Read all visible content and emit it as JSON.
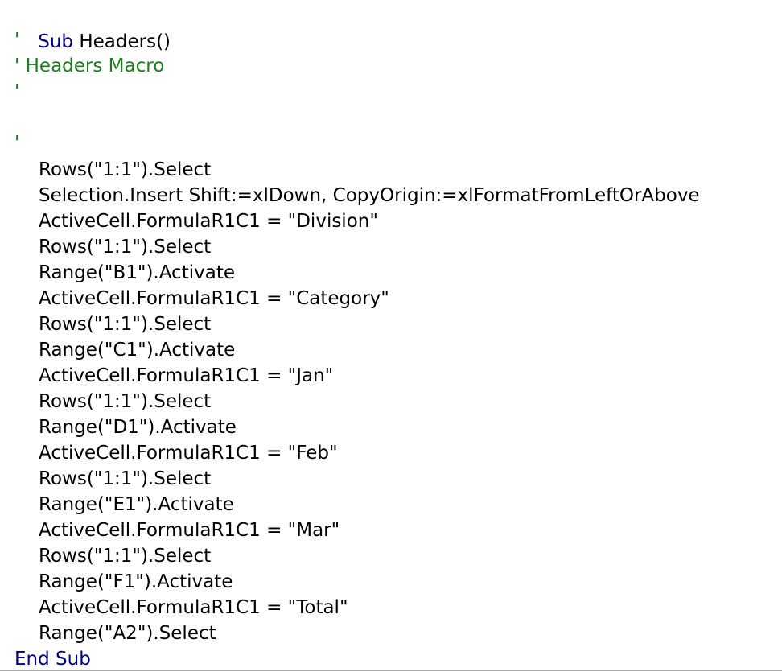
{
  "editor": {
    "keyword_color": "#00007f",
    "comment_color": "#1e7b1e",
    "text_color": "#000000",
    "sub_keyword": "Sub",
    "sub_name": "Headers()",
    "end_sub": "End Sub",
    "comment_lines": [
      "'",
      "' Headers Macro",
      "'",
      "'"
    ],
    "code_lines": [
      "Rows(\"1:1\").Select",
      "Selection.Insert Shift:=xlDown, CopyOrigin:=xlFormatFromLeftOrAbove",
      "ActiveCell.FormulaR1C1 = \"Division\"",
      "Rows(\"1:1\").Select",
      "Range(\"B1\").Activate",
      "ActiveCell.FormulaR1C1 = \"Category\"",
      "Rows(\"1:1\").Select",
      "Range(\"C1\").Activate",
      "ActiveCell.FormulaR1C1 = \"Jan\"",
      "Rows(\"1:1\").Select",
      "Range(\"D1\").Activate",
      "ActiveCell.FormulaR1C1 = \"Feb\"",
      "Rows(\"1:1\").Select",
      "Range(\"E1\").Activate",
      "ActiveCell.FormulaR1C1 = \"Mar\"",
      "Rows(\"1:1\").Select",
      "Range(\"F1\").Activate",
      "ActiveCell.FormulaR1C1 = \"Total\"",
      "Range(\"A2\").Select"
    ]
  }
}
